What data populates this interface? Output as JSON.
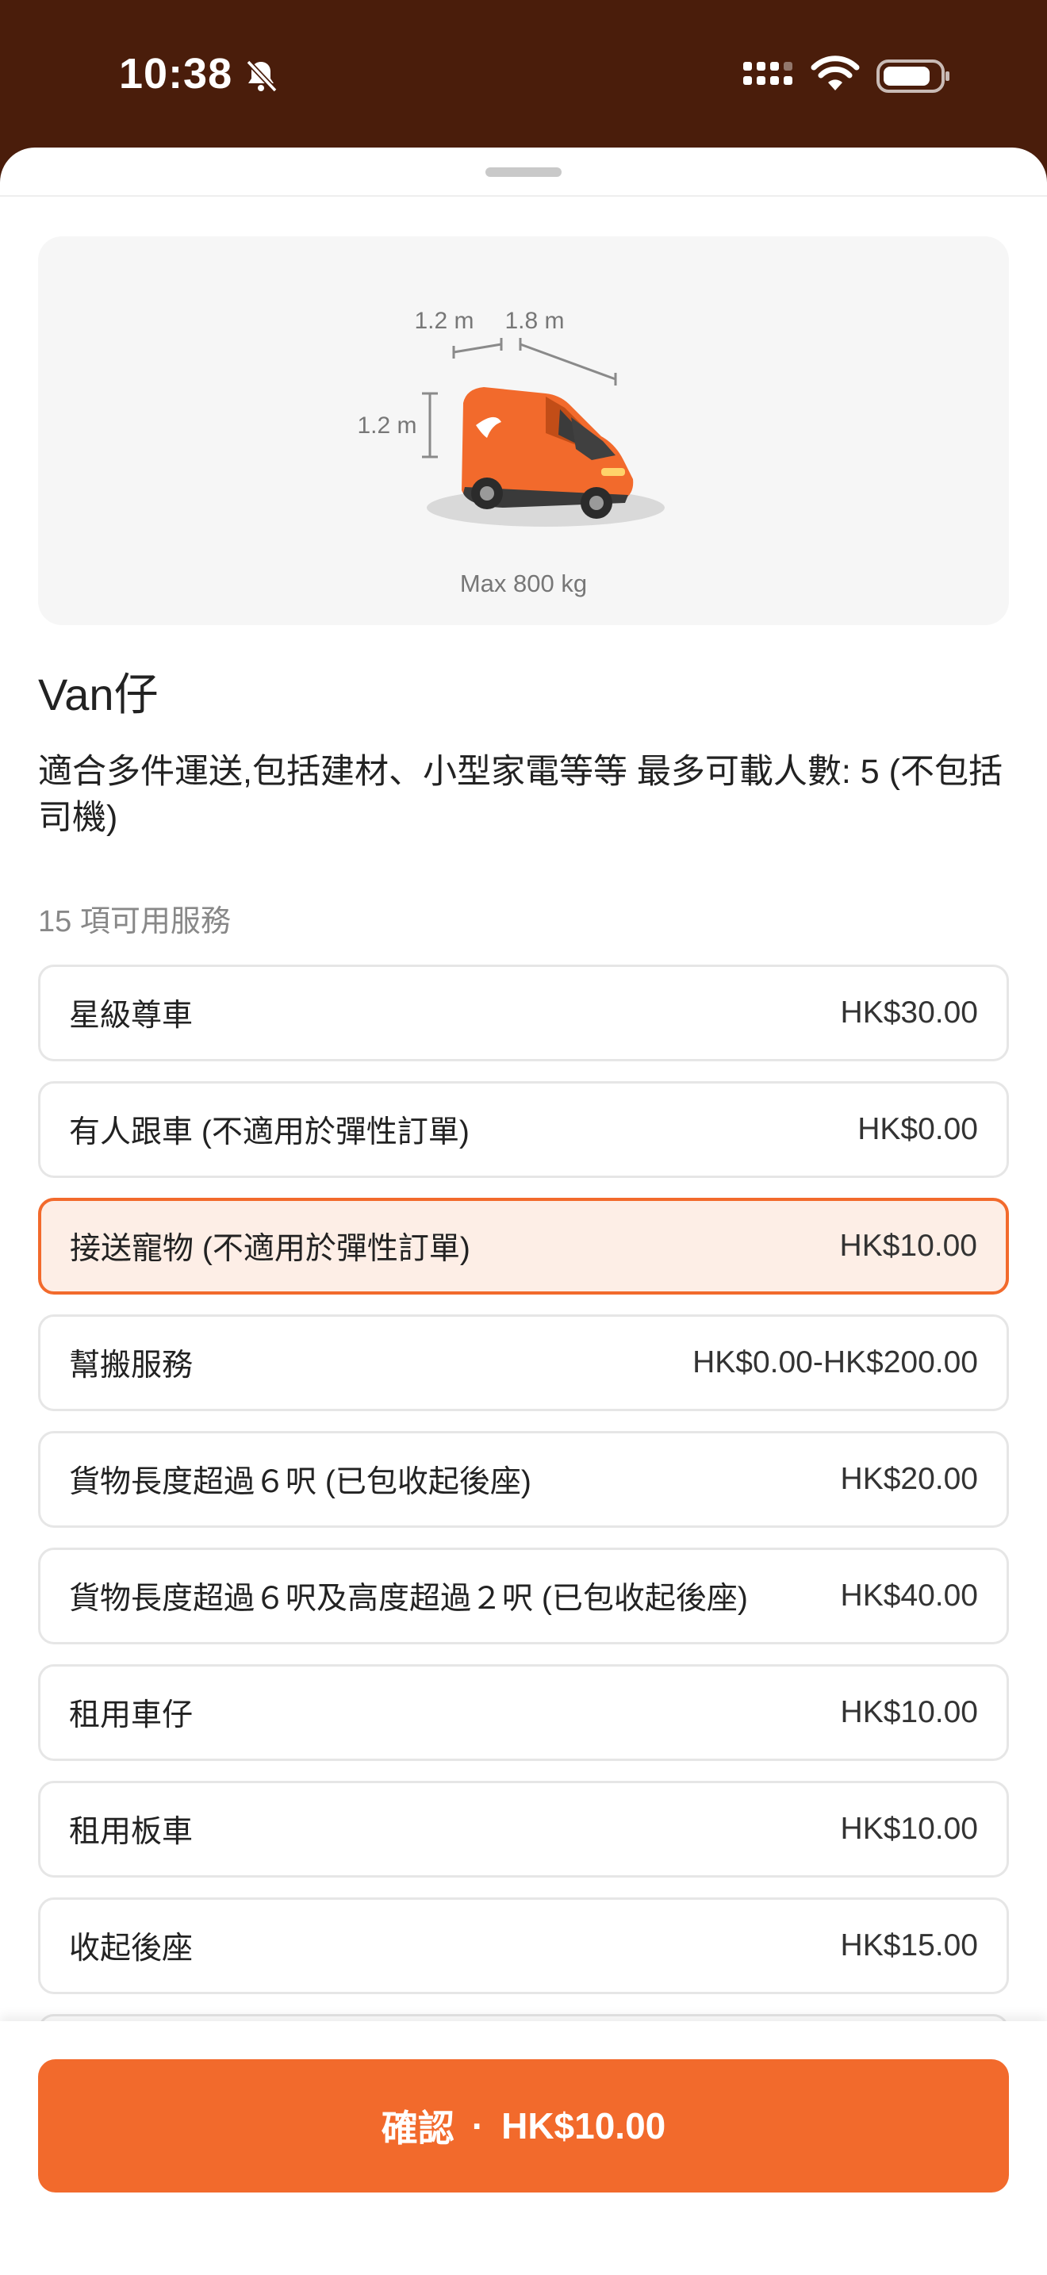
{
  "status_bar": {
    "time": "10:38",
    "icons": [
      "bell-off-icon",
      "signal-icon",
      "wifi-icon",
      "battery-icon"
    ]
  },
  "vehicle": {
    "dimensions": {
      "width": "1.2 m",
      "length": "1.8 m",
      "height": "1.2 m"
    },
    "max_load": "Max 800 kg",
    "name": "Van仔",
    "description": "適合多件運送,包括建材、小型家電等等 最多可載人數: 5 (不包括司機)"
  },
  "services": {
    "count_label": "15 項可用服務",
    "items": [
      {
        "name": "星級尊車",
        "price": "HK$30.00",
        "selected": false
      },
      {
        "name": "有人跟車 (不適用於彈性訂單)",
        "price": "HK$0.00",
        "selected": false
      },
      {
        "name": "接送寵物 (不適用於彈性訂單)",
        "price": "HK$10.00",
        "selected": true
      },
      {
        "name": "幫搬服務",
        "price": "HK$0.00-HK$200.00",
        "selected": false
      },
      {
        "name": "貨物長度超過６呎  (已包收起後座)",
        "price": "HK$20.00",
        "selected": false
      },
      {
        "name": "貨物長度超過６呎及高度超過２呎 (已包收起後座)",
        "price": "HK$40.00",
        "selected": false
      },
      {
        "name": "租用車仔",
        "price": "HK$10.00",
        "selected": false
      },
      {
        "name": "租用板車",
        "price": "HK$10.00",
        "selected": false
      },
      {
        "name": "收起後座",
        "price": "HK$15.00",
        "selected": false
      }
    ]
  },
  "confirm": {
    "label": "確認",
    "separator": "·",
    "total": "HK$10.00"
  },
  "colors": {
    "brand_orange": "#f26a2c",
    "status_bar_bg": "#4a1d0b",
    "selected_bg": "#fdeee6"
  }
}
